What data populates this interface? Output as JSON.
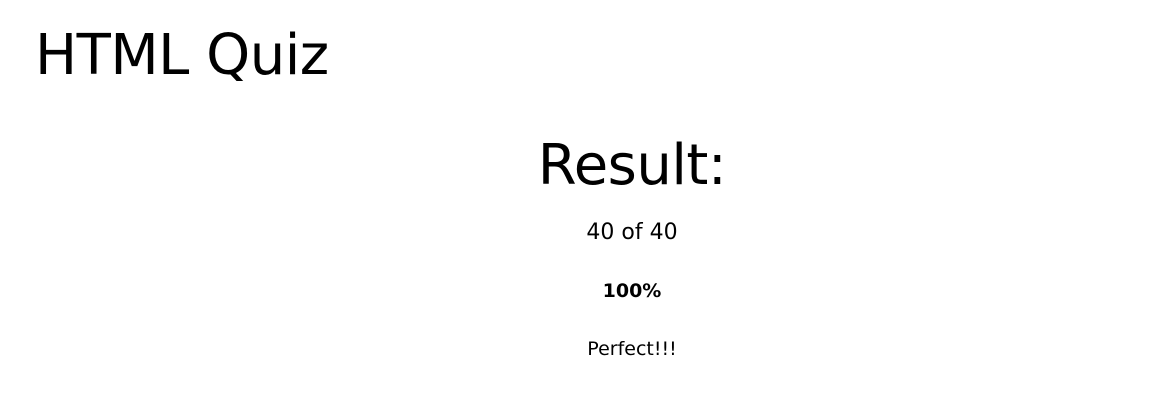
{
  "header": {
    "title": "HTML Quiz"
  },
  "result": {
    "heading": "Result:",
    "score_text": "40 of 40",
    "correct": 40,
    "total": 40,
    "percentage_text": "100%",
    "message": "Perfect!!!"
  }
}
